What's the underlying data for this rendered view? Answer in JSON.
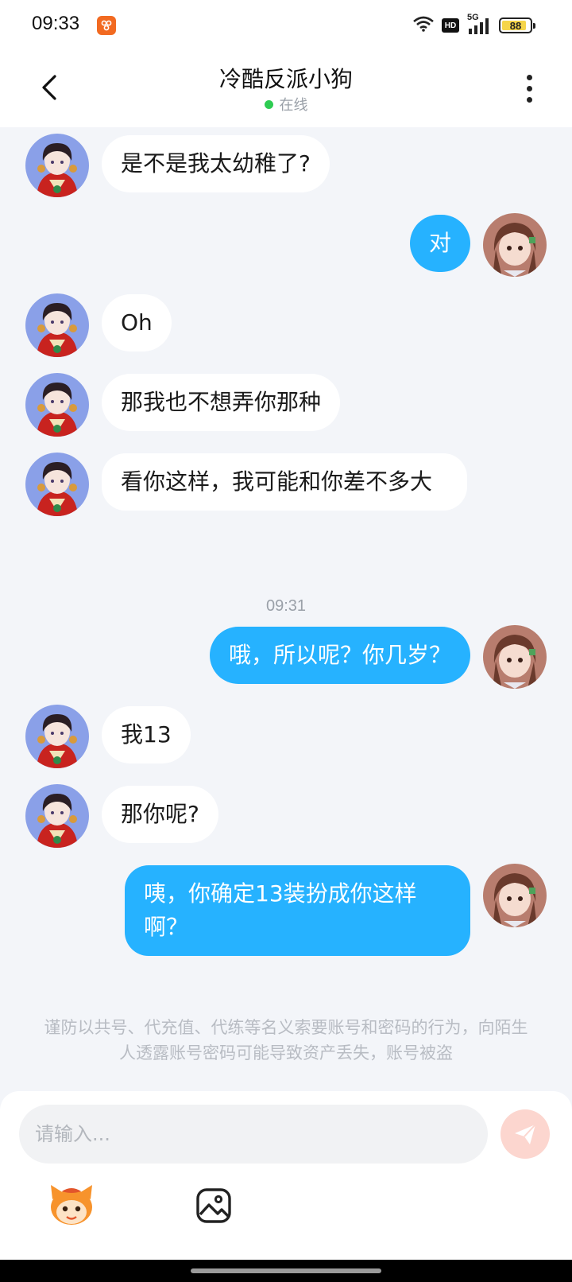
{
  "status_bar": {
    "time": "09:33",
    "network": "5G",
    "hd_label": "HD",
    "battery": "88",
    "icons": [
      "app-icon",
      "wifi-icon",
      "hd-icon",
      "signal-icon",
      "battery-icon"
    ]
  },
  "header": {
    "title": "冷酷反派小狗",
    "status": "在线",
    "status_color": "#2ecc52",
    "back_icon": "chevron-left-icon",
    "more_icon": "more-vertical-icon"
  },
  "messages": [
    {
      "side": "left",
      "text": "是不是我太幼稚了?"
    },
    {
      "side": "right",
      "text": "对"
    },
    {
      "side": "left",
      "text": "Oh"
    },
    {
      "side": "left",
      "text": "那我也不想弄你那种"
    },
    {
      "side": "left",
      "text": "看你这样，我可能和你差不多大"
    },
    {
      "side": "right",
      "text": "哦，所以呢？你几岁？"
    },
    {
      "side": "left",
      "text": "我13"
    },
    {
      "side": "left",
      "text": "那你呢?"
    },
    {
      "side": "right",
      "text": "咦，你确定13装扮成你这样啊？"
    }
  ],
  "time_divider": "09:31",
  "safety_notice": "谨防以共号、代充值、代练等名义索要账号和密码的行为，向陌生人透露账号密码可能导致资产丢失，账号被盗",
  "input": {
    "placeholder": "请输入...",
    "value": "",
    "send_icon": "send-icon",
    "mascot_icon": "mascot-icon",
    "image_icon": "image-icon"
  },
  "colors": {
    "accent": "#26b2ff",
    "background": "#f3f5f9",
    "send_disabled": "#fcd6cf"
  }
}
